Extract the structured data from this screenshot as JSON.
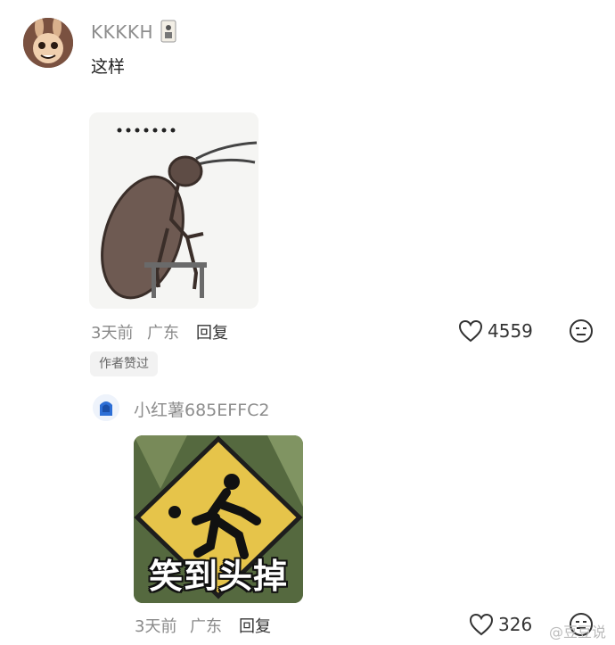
{
  "comment1": {
    "username": "KKKKH",
    "text": "这样",
    "time": "3天前",
    "location": "广东",
    "reply_label": "回复",
    "likes": "4559",
    "author_badge": "作者赞过"
  },
  "comment2": {
    "username": "小红薯685EFFC2",
    "image_caption": "笑到头掉",
    "time": "3天前",
    "location": "广东",
    "reply_label": "回复",
    "likes": "326",
    "icons": [
      "hoodie-avatar",
      "heart-icon",
      "face-icon"
    ]
  },
  "colors": {
    "muted": "#8a8a8a",
    "pill_bg": "#f2f2f2",
    "text": "#222222"
  },
  "watermark": "@豆豆说"
}
